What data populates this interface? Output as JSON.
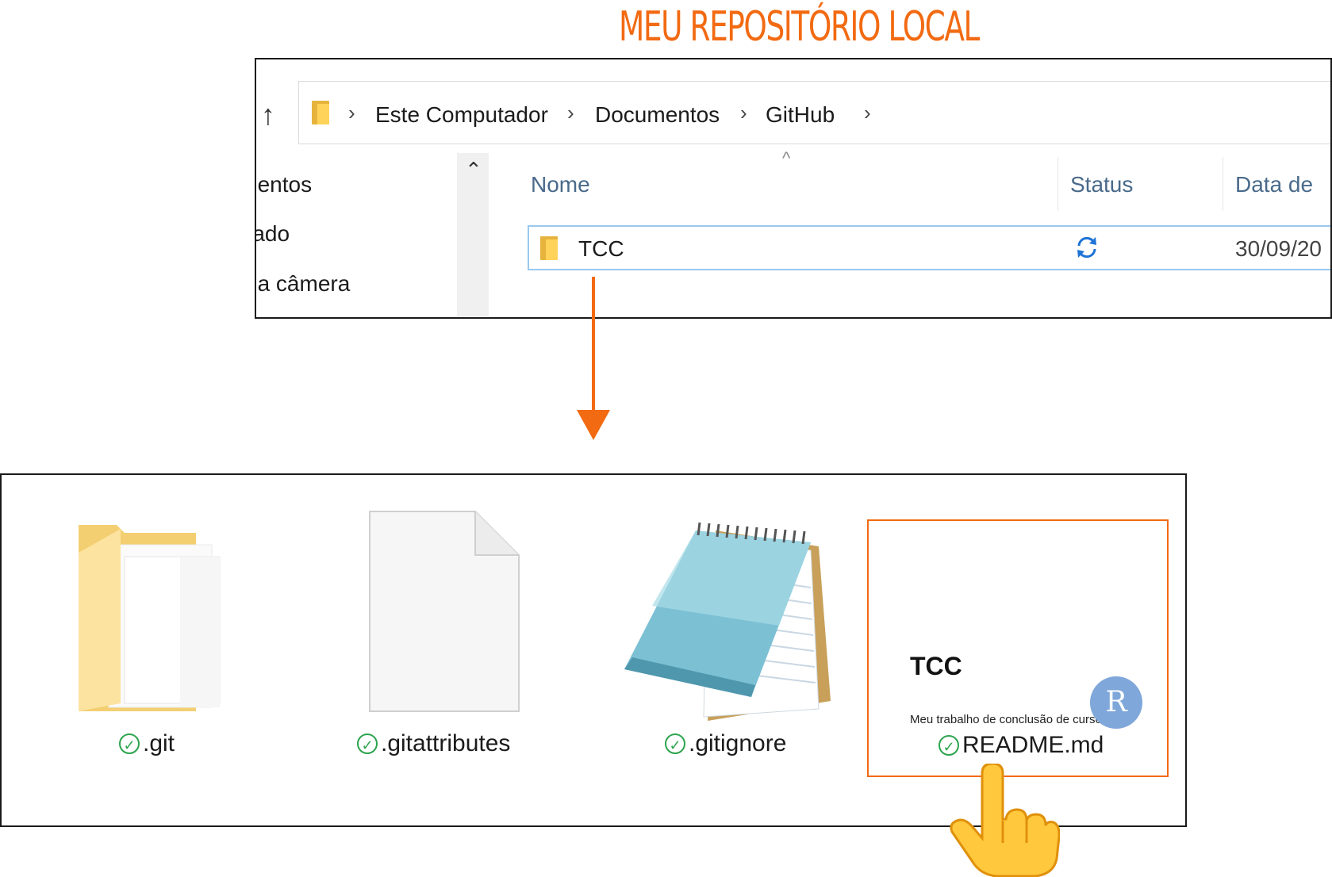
{
  "heading": "MEU REPOSITÓRIO LOCAL",
  "explorer": {
    "breadcrumb": [
      "Este Computador",
      "Documentos",
      "GitHub"
    ],
    "sidebar_items": [
      "nentos",
      "rado",
      "da câmera"
    ],
    "columns": {
      "name": "Nome",
      "status": "Status",
      "date": "Data de"
    },
    "rows": [
      {
        "name": "TCC",
        "status_icon": "sync-icon",
        "date": "30/09/20"
      }
    ]
  },
  "files": [
    {
      "name": ".git",
      "icon": "folder-icon",
      "status_icon": "check-icon"
    },
    {
      "name": ".gitattributes",
      "icon": "blank-file-icon",
      "status_icon": "check-icon"
    },
    {
      "name": ".gitignore",
      "icon": "notepad-icon",
      "status_icon": "check-icon"
    },
    {
      "name": "README.md",
      "icon": "readme-preview",
      "status_icon": "check-icon"
    }
  ],
  "readme_preview": {
    "title": "TCC",
    "description": "Meu trabalho de conclusão de curso",
    "badge": "R"
  },
  "colors": {
    "accent": "#f26a12",
    "check": "#2da44e",
    "selection": "#99c9ef"
  }
}
